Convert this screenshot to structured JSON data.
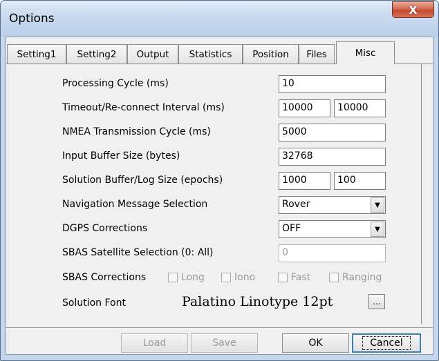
{
  "window": {
    "title": "Options",
    "close_glyph": "X"
  },
  "tabs": [
    {
      "label": "Setting1",
      "active": false
    },
    {
      "label": "Setting2",
      "active": false
    },
    {
      "label": "Output",
      "active": false
    },
    {
      "label": "Statistics",
      "active": false
    },
    {
      "label": "Position",
      "active": false
    },
    {
      "label": "Files",
      "active": false
    },
    {
      "label": "Misc",
      "active": true
    }
  ],
  "fields": {
    "processing_cycle": {
      "label": "Processing Cycle (ms)",
      "value": "10"
    },
    "timeout": {
      "label": "Timeout/Re-connect Interval (ms)",
      "value1": "10000",
      "value2": "10000"
    },
    "nmea_cycle": {
      "label": "NMEA Transmission Cycle (ms)",
      "value": "5000"
    },
    "input_buffer": {
      "label": "Input Buffer Size (bytes)",
      "value": "32768"
    },
    "solution_buffer": {
      "label": "Solution Buffer/Log Size (epochs)",
      "value1": "1000",
      "value2": "100"
    },
    "nav_message": {
      "label": "Navigation Message Selection",
      "value": "Rover"
    },
    "dgps": {
      "label": "DGPS Corrections",
      "value": "OFF"
    },
    "sbas_sat": {
      "label": "SBAS Satellite Selection (0: All)",
      "value": "0"
    },
    "sbas_corr": {
      "label": "SBAS Corrections",
      "options": [
        "Long",
        "Iono",
        "Fast",
        "Ranging"
      ]
    },
    "solution_font": {
      "label": "Solution Font",
      "preview": "Palatino Linotype 12pt",
      "button": "..."
    }
  },
  "buttons": {
    "load": "Load",
    "save": "Save",
    "ok": "OK",
    "cancel": "Cancel"
  },
  "icons": {
    "dropdown": "chevron-down-icon",
    "close": "close-icon"
  },
  "colors": {
    "title_bg": "#c9daef",
    "close_btn": "#c44a2f",
    "default_btn_border": "#3c7fb1"
  }
}
